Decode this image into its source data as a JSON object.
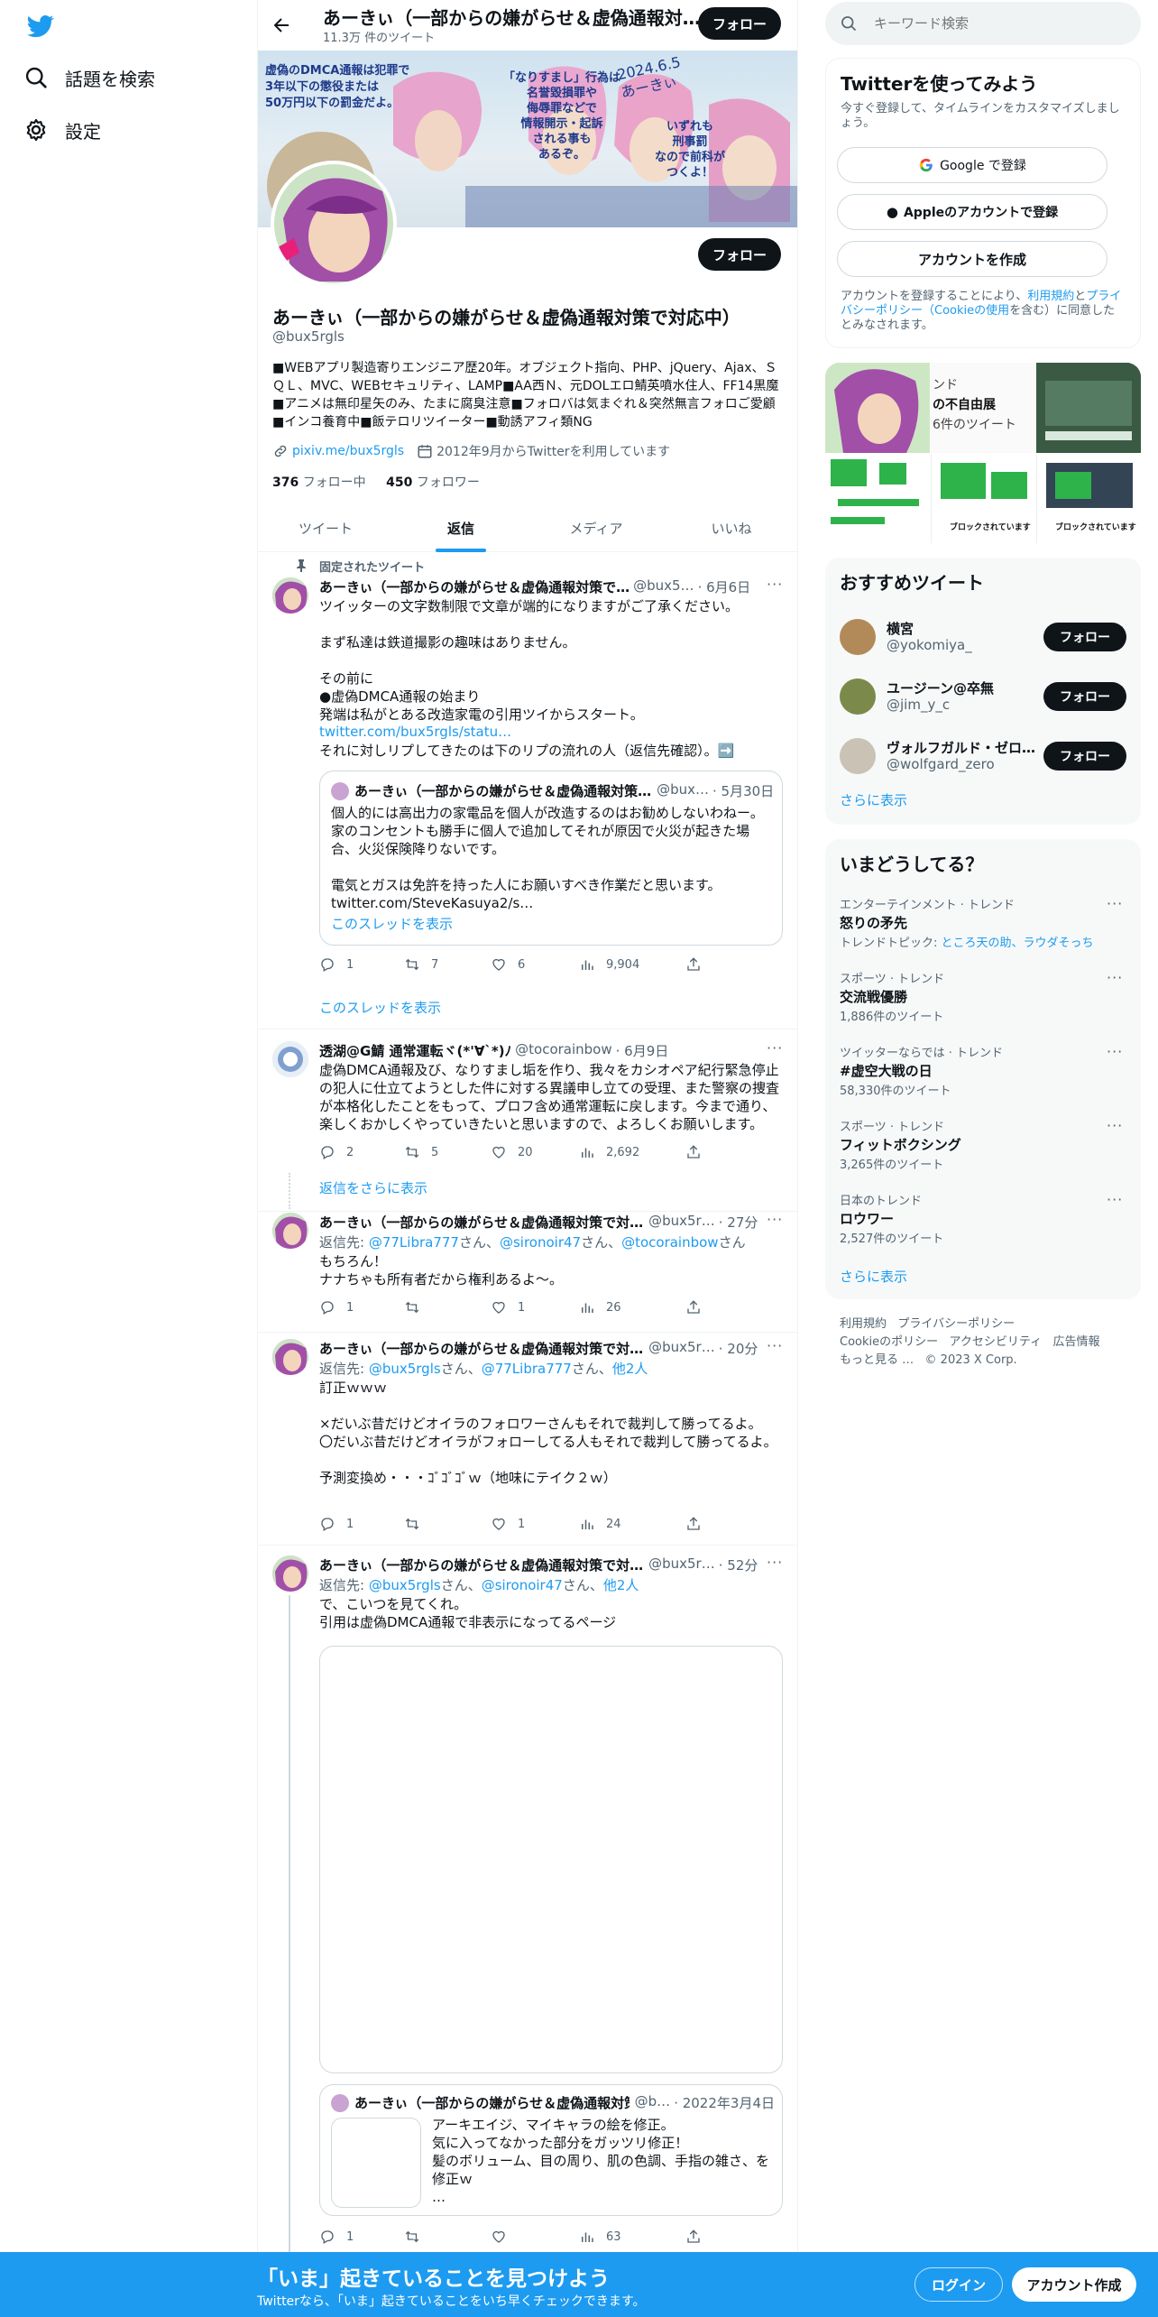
{
  "nav": {
    "explore_label": "話題を検索",
    "settings_label": "設定"
  },
  "header": {
    "title": "あーきぃ（一部からの嫌がらせ＆虚偽通報対…",
    "tweet_count": "11.3万 件のツイート",
    "follow_label": "フォロー"
  },
  "banner": {
    "text_left": "虚偽のDMCA通報は犯罪で\n3年以下の懲役または\n50万円以下の罰金だよ。",
    "text_mid": "「なりすまし」行為は\n名誉毀損罪や\n侮辱罪などで\n情報開示・起訴\nされる事も\nあるぞ。",
    "text_date": "2024.6.5\nあーきぃ",
    "text_right": "いずれも\n刑事罰\nなので前科が\nつくよ！"
  },
  "profile": {
    "name": "あーきぃ（一部からの嫌がらせ＆虚偽通報対策で対応中）",
    "handle": "@bux5rgls",
    "bio": "■WEBアプリ製造寄りエンジニア歴20年。オブジェクト指向、PHP、jQuery、Ajax、ＳＱＬ、MVC、WEBセキュリティ、LAMP■AA西Ｎ、元DOLエロ鯖英噴水住人、FF14黒魔■アニメは無印星矢のみ、たまに腐臭注意■フォロバは気まぐれ＆突然無言フォロご愛顧■インコ養育中■飯テロリツイーター■動誘アフィ類NG",
    "website": "pixiv.me/bux5rgls",
    "joined": "2012年9月からTwitterを利用しています",
    "following_count": "376",
    "following_label": "フォロー中",
    "followers_count": "450",
    "followers_label": "フォロワー",
    "follow_label": "フォロー"
  },
  "tabs": [
    {
      "label": "ツイート"
    },
    {
      "label": "返信"
    },
    {
      "label": "メディア"
    },
    {
      "label": "いいね"
    }
  ],
  "pinned": {
    "pinned_label": "固定されたツイート",
    "name": "あーきぃ（一部からの嫌がらせ＆虚偽通報対策で…",
    "handle": "@bux5…",
    "date": "· 6月6日",
    "text": "ツイッターの文字数制限で文章が端的になりますがご了承ください。\n\nまず私達は鉄道撮影の趣味はありません。\n\nその前に\n●虚偽DMCA通報の始まり\n発端は私がとある改造家電の引用ツイからスタート。",
    "link": "twitter.com/bux5rgls/statu…",
    "text2": "それに対しリプしてきたのは下のリプの流れの人（返信先確認）。➡️",
    "quote": {
      "name": "あーきぃ（一部からの嫌がらせ＆虚偽通報対策…",
      "handle": "@bux…",
      "date": "· 5月30日",
      "text": "個人的には高出力の家電品を個人が改造するのはお勧めしないわねー。\n家のコンセントも勝手に個人で追加してそれが原因で火災が起きた場合、火災保険降りないです。\n\n電気とガスは免許を持った人にお願いすべき作業だと思います。\ntwitter.com/SteveKasuya2/s…",
      "show_thread": "このスレッドを表示"
    },
    "replies": "1",
    "retweets": "7",
    "likes": "6",
    "views": "9,904",
    "show_thread": "このスレッドを表示"
  },
  "tweet2": {
    "name": "透湖@G鯖 通常運転ヾ(*'∀`*)ﾉ",
    "handle": "@tocorainbow",
    "date": "· 6月9日",
    "text": "虚偽DMCA通報及び、なりすまし垢を作り、我々をカシオペア紀行緊急停止の犯人に仕立てようとした件に対する異議申し立ての受理、また警察の捜査が本格化したことをもって、プロフ含め通常運転に戻します。今まで通り、楽しくおかしくやっていきたいと思いますので、よろしくお願いします。",
    "replies": "2",
    "retweets": "5",
    "likes": "20",
    "views": "2,692",
    "show_more": "返信をさらに表示"
  },
  "tweet3": {
    "name": "あーきぃ（一部からの嫌がらせ＆虚偽通報対策で対…",
    "handle": "@bux5r…",
    "date": "· 27分",
    "reply_prefix": "返信先: ",
    "reply_to_1": "@77Libra777",
    "reply_to_2": "@sironoir47",
    "reply_to_3": "@tocorainbow",
    "san": "さん、",
    "san_end": "さん",
    "text": "もちろん！\nナナちゃも所有者だから権利あるよ～。",
    "replies": "1",
    "retweets": "",
    "likes": "1",
    "views": "26"
  },
  "tweet4": {
    "name": "あーきぃ（一部からの嫌がらせ＆虚偽通報対策で対…",
    "handle": "@bux5r…",
    "date": "· 20分",
    "reply_prefix": "返信先: ",
    "reply_to_1": "@bux5rgls",
    "reply_to_2": "@77Libra777",
    "reply_to_3": "他2人",
    "san": "さん、",
    "text": "訂正ｗｗｗ\n\n×だいぶ昔だけどオイラのフォロワーさんもそれで裁判して勝ってるよ。\n〇だいぶ昔だけどオイラがフォローしてる人もそれで裁判して勝ってるよ。\n\n予測変換め・・・ｺﾞｺﾞｺﾞｗ（地味にテイク２ｗ）",
    "replies": "1",
    "retweets": "",
    "likes": "1",
    "views": "24"
  },
  "tweet5": {
    "name": "あーきぃ（一部からの嫌がらせ＆虚偽通報対策で対…",
    "handle": "@bux5r…",
    "date": "· 52分",
    "reply_prefix": "返信先: ",
    "reply_to_1": "@bux5rgls",
    "reply_to_2": "@sironoir47",
    "reply_to_3": "他2人",
    "san": "さん、",
    "text": "で、こいつを見てくれ。\n引用は虚偽DMCA通報で非表示になってるページ",
    "quote": {
      "name": "あーきぃ（一部からの嫌がらせ＆虚偽通報対策…",
      "handle": "@b…",
      "date": "· 2022年3月4日",
      "text": "アーキエイジ、マイキャラの絵を修正。\n気に入ってなかった部分をガッツリ修正！\n髪のボリューム、目の周り、肌の色調、手指の雑さ、を修正ｗ\n…"
    },
    "replies": "1",
    "retweets": "",
    "likes": "",
    "views": "63"
  },
  "search": {
    "placeholder": "キーワード検索"
  },
  "signup": {
    "title": "Twitterを使ってみよう",
    "subtitle": "今すぐ登録して、タイムラインをカスタマイズしましょう。",
    "google": "Google で登録",
    "apple": "Appleのアカウントで登録",
    "create": "アカウントを作成",
    "legal_1": "アカウントを登録することにより、",
    "legal_terms": "利用規約",
    "legal_2": "と",
    "legal_privacy": "プライバシーポリシー（Cookieの使用",
    "legal_3": "を含む）に同意したとみなされます。"
  },
  "media_grid": {
    "overlay_1": "ンド",
    "overlay_2": "の不自由展",
    "overlay_3": "6件のツイート",
    "caption_1": "ブロックされています",
    "caption_2": "ブロックされています"
  },
  "recommended": {
    "title": "おすすめツイート",
    "users": [
      {
        "name": "横宮",
        "handle": "@yokomiya_"
      },
      {
        "name": "ユージーン@卒無",
        "handle": "@jim_y_c"
      },
      {
        "name": "ヴォルフガルド・ゼロ…",
        "handle": "@wolfgard_zero"
      }
    ],
    "follow_label": "フォロー",
    "show_more": "さらに表示"
  },
  "trends": {
    "title": "いまどうしてる？",
    "items": [
      {
        "category": "エンターテインメント · トレンド",
        "name": "怒りの矛先",
        "meta_prefix": "トレンドトピック: ",
        "meta_links": "ところ天の助、ラウダそっち"
      },
      {
        "category": "スポーツ · トレンド",
        "name": "交流戦優勝",
        "meta": "1,886件のツイート"
      },
      {
        "category": "ツイッターならでは · トレンド",
        "name": "#虚空大戦の日",
        "meta": "58,330件のツイート"
      },
      {
        "category": "スポーツ · トレンド",
        "name": "フィットボクシング",
        "meta": "3,265件のツイート"
      },
      {
        "category": "日本のトレンド",
        "name": "ロウワー",
        "meta": "2,527件のツイート"
      }
    ],
    "show_more": "さらに表示"
  },
  "footer": {
    "terms": "利用規約",
    "privacy": "プライバシーポリシー",
    "cookie": "Cookieのポリシー",
    "accessibility": "アクセシビリティ",
    "ads": "広告情報",
    "more": "もっと見る …",
    "copyright": "© 2023 X Corp."
  },
  "bottom": {
    "headline": "「いま」起きていることを見つけよう",
    "sub": "Twitterなら、「いま」起きていることをいち早くチェックできます。",
    "login": "ログイン",
    "signup": "アカウント作成"
  },
  "colors": {
    "accent": "#1d9bf0",
    "text": "#0f1419",
    "secondary": "#536471"
  }
}
